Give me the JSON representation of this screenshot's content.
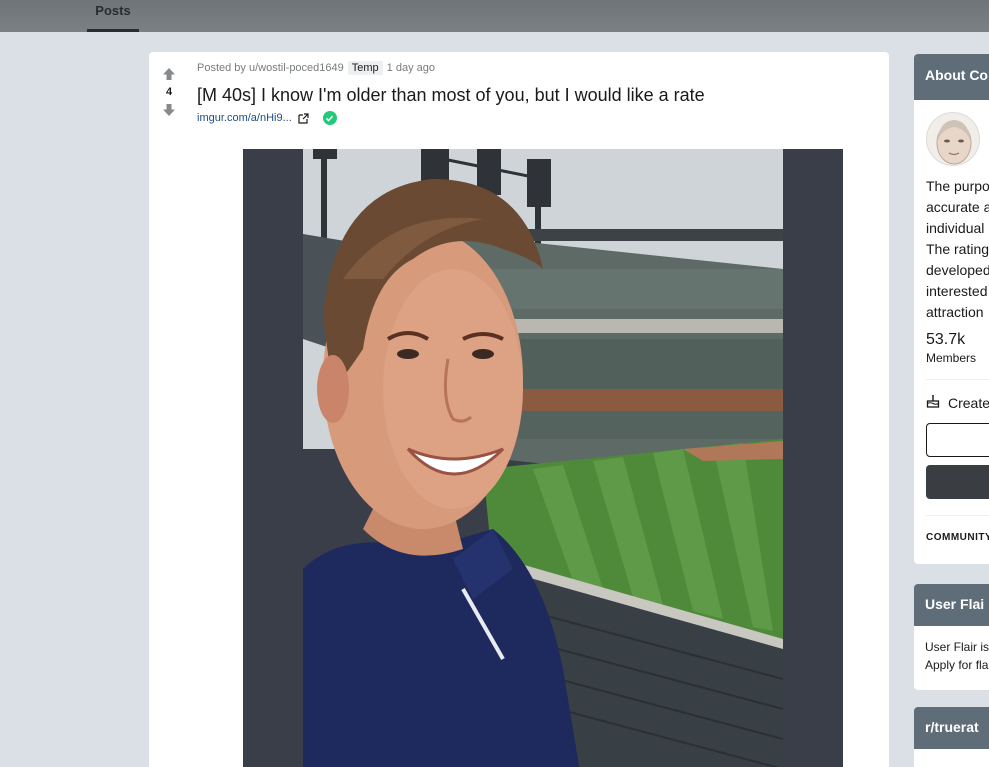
{
  "nav": {
    "tab_posts": "Posts"
  },
  "post": {
    "vote_count": "4",
    "posted_by": "Posted by u/wostil-poced1649",
    "flair": "Temp",
    "time": "1 day ago",
    "title": "[M 40s] I know I'm older than most of you, but I would like a rate",
    "link_text": "imgur.com/a/nHi9...",
    "image_alt": "Selfie of a smiling man in a navy polo shirt at a baseball stadium"
  },
  "sidebar": {
    "about_title": "About Co",
    "about_desc_lines": [
      "The purpo",
      "accurate a",
      "individual",
      "The rating",
      "developed",
      "interested",
      "attraction"
    ],
    "members_count": "53.7k",
    "members_label": "Members",
    "create_label": "Create",
    "community_options": "COMMUNITY",
    "user_flair_title": "User Flai",
    "user_flair_lines": [
      "User Flair is",
      "Apply for fla"
    ],
    "third_title": "r/truerat"
  },
  "colors": {
    "page_bg": "#dae0e6",
    "nav_bg": "#6e7478",
    "sidebar_header": "#5f6d79",
    "verified_green": "#23c97a"
  }
}
